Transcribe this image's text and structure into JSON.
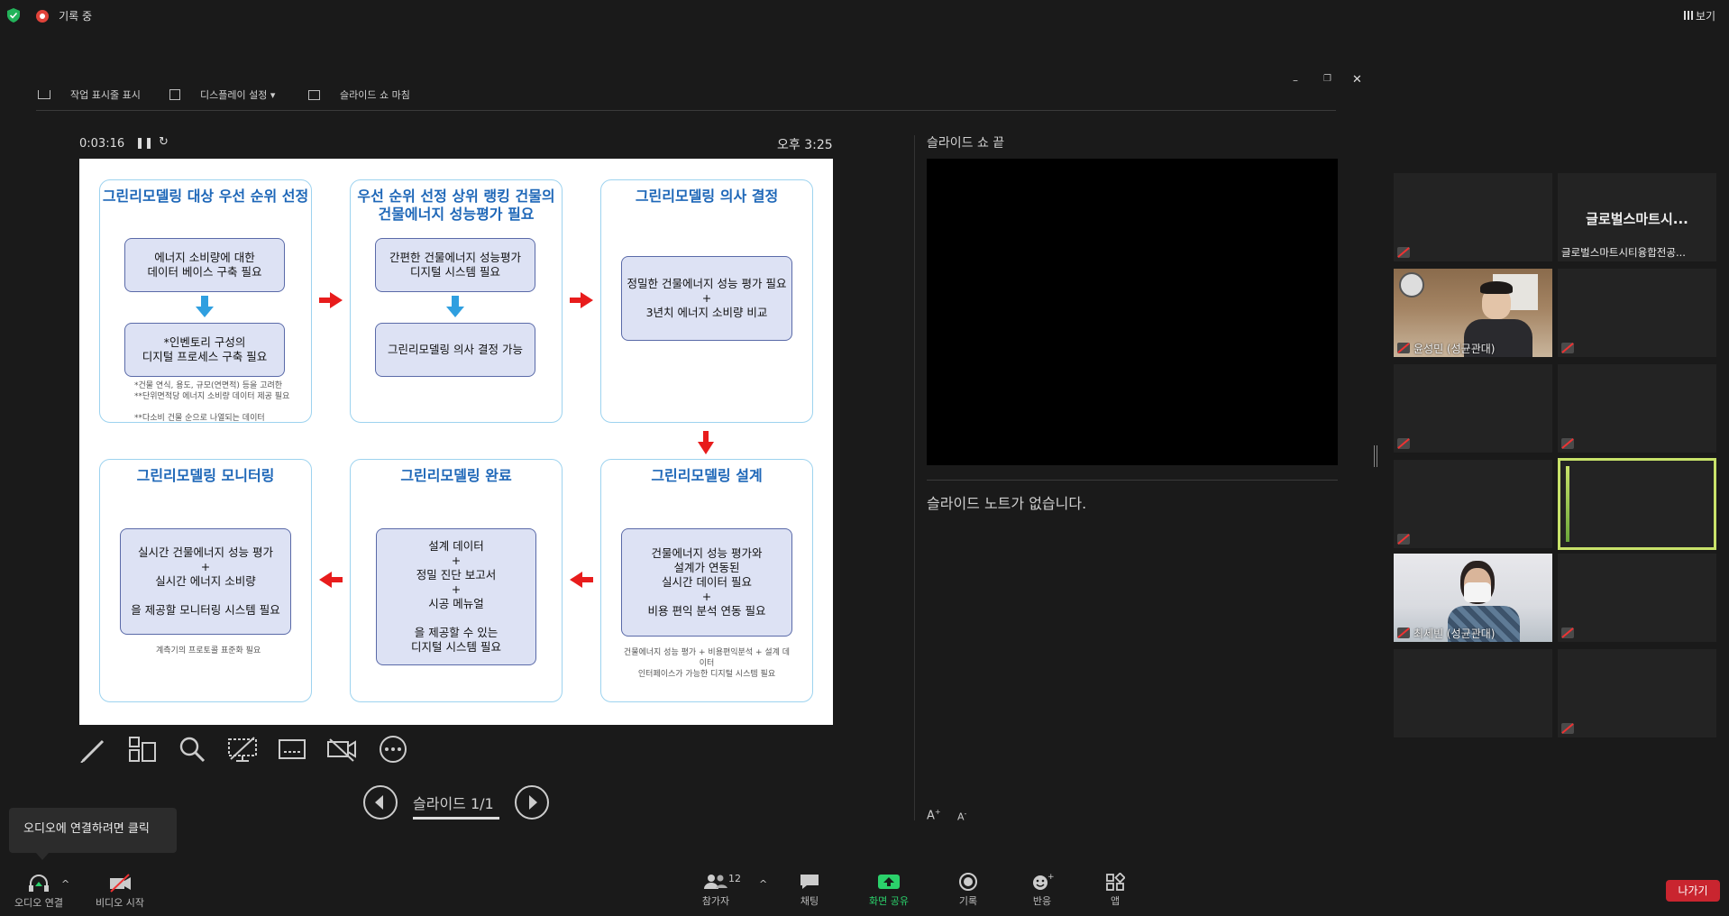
{
  "topbar": {
    "recording_label": "기록 중",
    "view_label": "보기"
  },
  "presenter_toolbar": {
    "show_taskbar": "작업 표시줄 표시",
    "display_settings": "디스플레이 설정 ▾",
    "end_slideshow": "슬라이드 쇼 마침"
  },
  "timer": {
    "elapsed": "0:03:16",
    "clock": "오후 3:25"
  },
  "next_slide": {
    "label": "슬라이드 쇼 끝"
  },
  "notes": {
    "empty": "슬라이드 노트가 없습니다."
  },
  "slide_nav": {
    "label": "슬라이드 1/1"
  },
  "slide": {
    "panels": [
      {
        "title": "그린리모델링 대상 우선 순위 선정",
        "box1": "에너지 소비량에 대한\n데이터 베이스 구축 필요",
        "box2": "*인벤토리 구성의\n디지털 프로세스 구축 필요",
        "note": "*건물 연식, 용도, 규모(연면적) 등을 고려한\n**단위면적당 에너지 소비량 데이터 제공 필요\n\n**다소비 건물 순으로 나열되는 데이터"
      },
      {
        "title": "우선 순위 선정 상위 랭킹 건물의\n건물에너지 성능평가 필요",
        "box1": "간편한 건물에너지 성능평가\n디지털 시스템 필요",
        "box2": "그린리모델링 의사 결정 가능"
      },
      {
        "title": "그린리모델링 의사 결정",
        "box1": "정밀한 건물에너지 성능 평가 필요\n+\n3년치 에너지 소비량 비교"
      },
      {
        "title": "그린리모델링 모니터링",
        "box1": "실시간 건물에너지 성능 평가\n+\n실시간 에너지 소비량\n\n을 제공할 모니터링 시스템 필요",
        "note": "계측기의 프로토콜 표준화 필요"
      },
      {
        "title": "그린리모델링 완료",
        "box1": "설계 데이터\n+\n정밀 진단 보고서\n+\n시공 메뉴얼\n\n을 제공할 수 있는\n디지털 시스템 필요"
      },
      {
        "title": "그린리모델링 설계",
        "box1": "건물에너지 성능 평가와\n설계가 연동된\n실시간 데이터 필요\n+\n비용 편익 분석 연동 필요",
        "note": "건물에너지 성능 평가 + 비용편익분석 + 설계 데이터\n인터페이스가 가능한 디지털 시스템 필요"
      }
    ]
  },
  "participants": [
    {
      "name": ""
    },
    {
      "name": "글로벌스마트시티융합전공...",
      "display": "글로벌스마트시..."
    },
    {
      "name": "윤성민 (성균관대)"
    },
    {
      "name": ""
    },
    {
      "name": ""
    },
    {
      "name": ""
    },
    {
      "name": ""
    },
    {
      "name": ""
    },
    {
      "name": "최세빈 (성균관대)"
    },
    {
      "name": ""
    },
    {
      "name": ""
    },
    {
      "name": ""
    }
  ],
  "tooltip": {
    "text": "오디오에 연결하려면 클릭"
  },
  "bottombar": {
    "audio": "오디오 연결",
    "video": "비디오 시작",
    "participants": "참가자",
    "participants_count": "12",
    "chat": "채팅",
    "share": "화면 공유",
    "record": "기록",
    "reactions": "반응",
    "apps": "앱",
    "leave": "나가기"
  },
  "colors": {
    "accent_green": "#2bd16b",
    "leave_red": "#c9252f",
    "slide_title_blue": "#1e67b8"
  }
}
